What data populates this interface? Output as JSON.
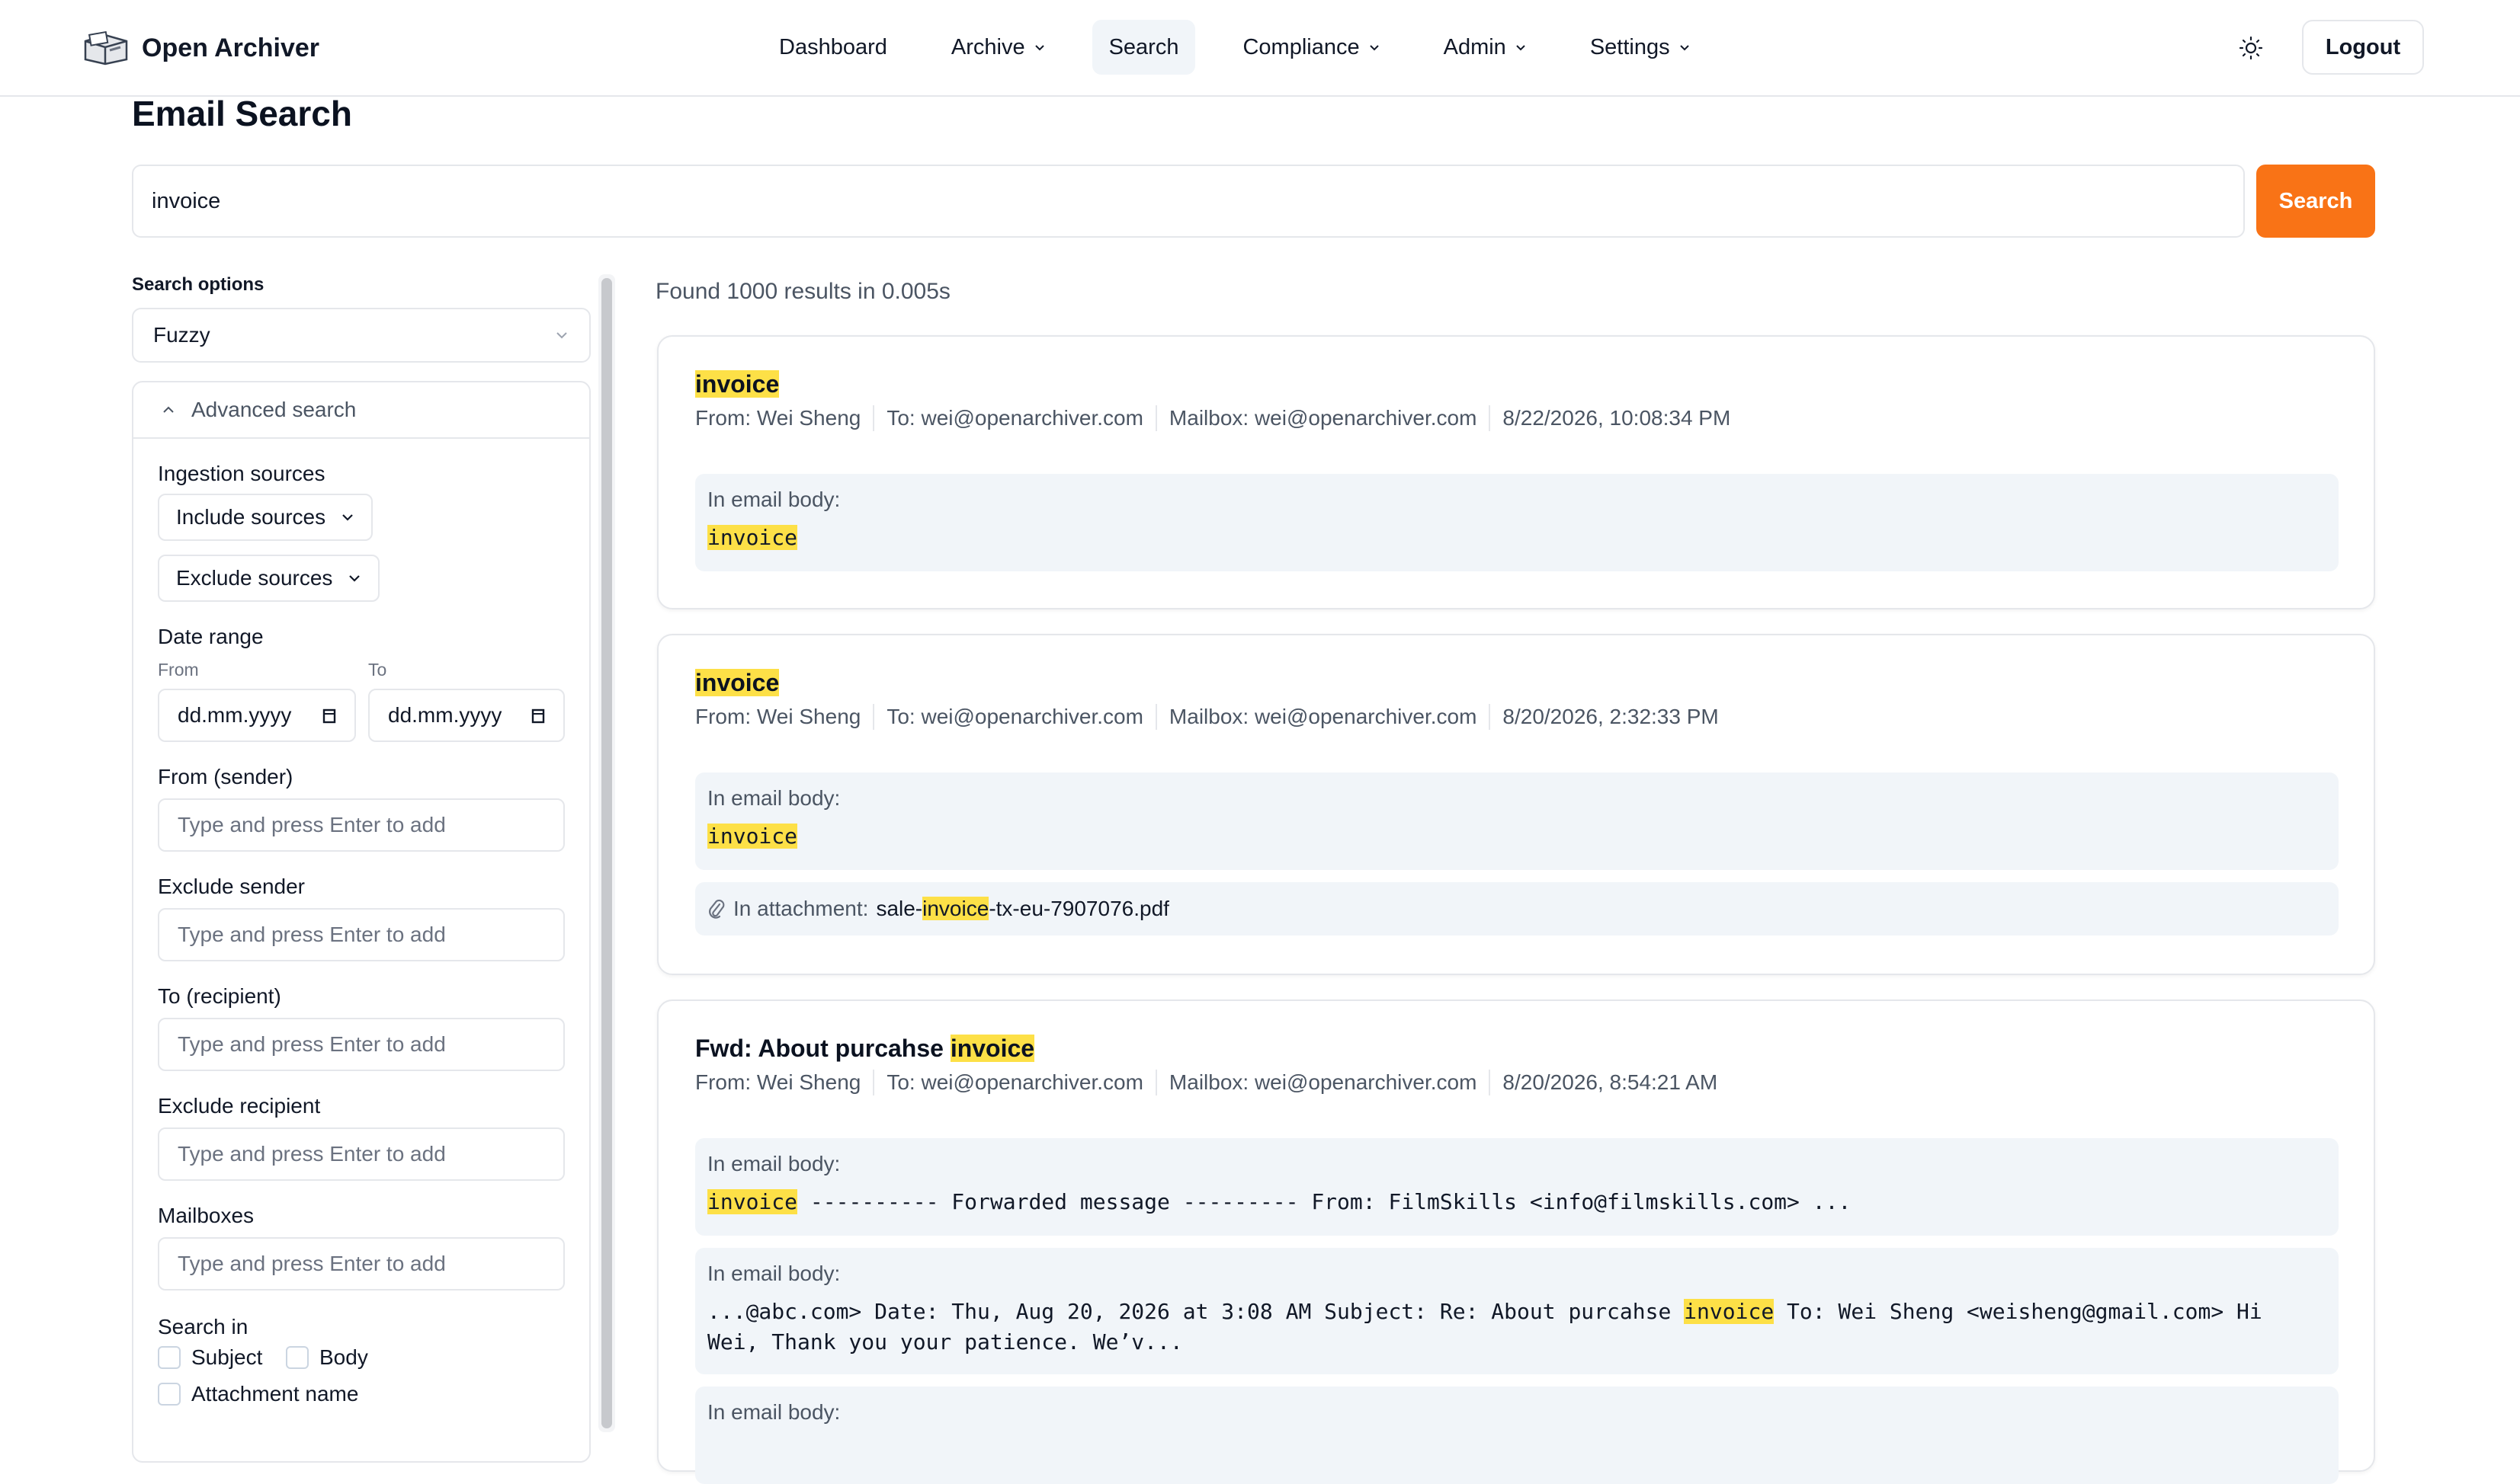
{
  "app": {
    "name": "Open Archiver"
  },
  "nav": {
    "items": [
      {
        "label": "Dashboard",
        "dropdown": false,
        "active": false
      },
      {
        "label": "Archive",
        "dropdown": true,
        "active": false
      },
      {
        "label": "Search",
        "dropdown": false,
        "active": true
      },
      {
        "label": "Compliance",
        "dropdown": true,
        "active": false
      },
      {
        "label": "Admin",
        "dropdown": true,
        "active": false
      },
      {
        "label": "Settings",
        "dropdown": true,
        "active": false
      }
    ],
    "logout_label": "Logout",
    "theme_icon": "sun-icon"
  },
  "page": {
    "title": "Email Search"
  },
  "search": {
    "query": "invoice",
    "button_label": "Search"
  },
  "sidebar": {
    "options_label": "Search options",
    "mode": "Fuzzy",
    "advanced_label": "Advanced search",
    "ingestion_label": "Ingestion sources",
    "include_sources": "Include sources",
    "exclude_sources": "Exclude sources",
    "date_range_label": "Date range",
    "from_label": "From",
    "to_label": "To",
    "date_from_placeholder": "dd.mm.yyyy",
    "date_to_placeholder": "dd.mm.yyyy",
    "sender_label": "From (sender)",
    "exclude_sender_label": "Exclude sender",
    "recipient_label": "To (recipient)",
    "exclude_recipient_label": "Exclude recipient",
    "mailboxes_label": "Mailboxes",
    "tag_placeholder": "Type and press Enter to add",
    "search_in_label": "Search in",
    "search_in": {
      "subject": "Subject",
      "body": "Body",
      "attachment_name": "Attachment name"
    }
  },
  "results": {
    "summary": "Found 1000 results in 0.005s",
    "highlight": "invoice",
    "cards": [
      {
        "title_pre": "",
        "from": "From: Wei Sheng",
        "to": "To: wei@openarchiver.com",
        "mailbox": "Mailbox: wei@openarchiver.com",
        "date": "8/22/2026, 10:08:34 PM",
        "snippet_label": "In email body:"
      },
      {
        "title_pre": "",
        "from": "From: Wei Sheng",
        "to": "To: wei@openarchiver.com",
        "mailbox": "Mailbox: wei@openarchiver.com",
        "date": "8/20/2026, 2:32:33 PM",
        "snippet_label": "In email body:",
        "attachment_label": "In attachment:",
        "attachment_pre": "sale-",
        "attachment_post": "-tx-eu-7907076.pdf"
      },
      {
        "title_pre": "Fwd: About purcahse ",
        "from": "From: Wei Sheng",
        "to": "To: wei@openarchiver.com",
        "mailbox": "Mailbox: wei@openarchiver.com",
        "date": "8/20/2026, 8:54:21 AM",
        "snippet_label": "In email body:",
        "snippet1_post": " ---------- Forwarded message --------- From: FilmSkills <info@filmskills.com> ...",
        "snippet2_pre": "...@abc.com> Date: Thu, Aug 20, 2026 at 3:08 AM Subject: Re: About purcahse ",
        "snippet2_post": " To: Wei Sheng <weisheng@gmail.com> Hi",
        "snippet2_line2": "Wei, Thank you your patience. We’v..."
      }
    ]
  },
  "colors": {
    "accent": "#f97316",
    "highlight": "#fde047",
    "snippet_bg": "#f1f5f9"
  }
}
